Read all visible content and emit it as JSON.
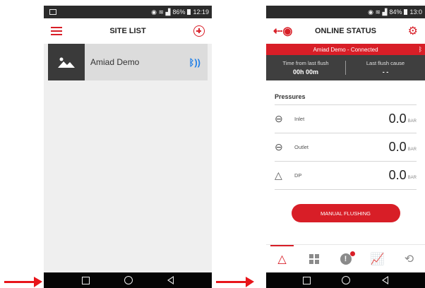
{
  "left": {
    "status": {
      "time": "12:19",
      "battery": "86%"
    },
    "header": {
      "title": "SITE LIST"
    },
    "sites": [
      {
        "name": "Amiad Demo"
      }
    ]
  },
  "right": {
    "status": {
      "time": "13:0",
      "battery": "84%"
    },
    "header": {
      "title": "ONLINE STATUS"
    },
    "connection": "Amiad Demo - Connected",
    "flush": {
      "time_label": "Time from last flush",
      "time_value": "00h 00m",
      "cause_label": "Last flush cause",
      "cause_value": "- -"
    },
    "pressures": {
      "title": "Pressures",
      "rows": [
        {
          "label": "Inlet",
          "value": "0.0",
          "unit": "BAR"
        },
        {
          "label": "Outlet",
          "value": "0.0",
          "unit": "BAR"
        },
        {
          "label": "DP",
          "value": "0.0",
          "unit": "BAR"
        }
      ]
    },
    "manual_button": "MANUAL FLUSHING"
  },
  "colors": {
    "accent": "#d81e27",
    "dark_panel": "#3f3f3f",
    "arrow": "#e8141a"
  }
}
